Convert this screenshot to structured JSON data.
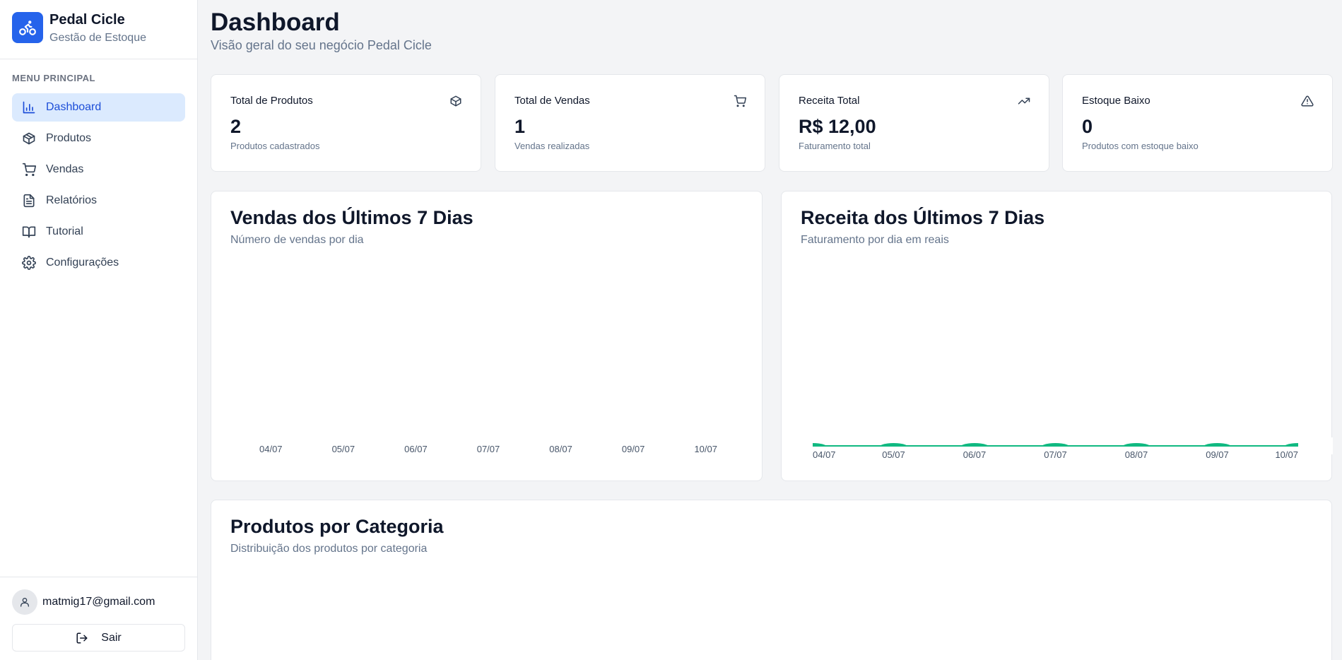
{
  "brand": {
    "name": "Pedal Cicle",
    "subtitle": "Gestão de Estoque"
  },
  "menu": {
    "title": "MENU PRINCIPAL",
    "items": [
      {
        "label": "Dashboard",
        "icon": "bar-chart-icon",
        "active": true
      },
      {
        "label": "Produtos",
        "icon": "package-icon"
      },
      {
        "label": "Vendas",
        "icon": "cart-icon"
      },
      {
        "label": "Relatórios",
        "icon": "file-text-icon"
      },
      {
        "label": "Tutorial",
        "icon": "book-icon"
      },
      {
        "label": "Configurações",
        "icon": "gear-icon"
      }
    ]
  },
  "user": {
    "email": "matmig17@gmail.com",
    "logout_label": "Sair"
  },
  "header": {
    "title": "Dashboard",
    "subtitle": "Visão geral do seu negócio Pedal Cicle"
  },
  "stats": [
    {
      "title": "Total de Produtos",
      "value": "2",
      "description": "Produtos cadastrados",
      "icon": "package-icon"
    },
    {
      "title": "Total de Vendas",
      "value": "1",
      "description": "Vendas realizadas",
      "icon": "cart-icon"
    },
    {
      "title": "Receita Total",
      "value": "R$ 12,00",
      "description": "Faturamento total",
      "icon": "trending-up-icon"
    },
    {
      "title": "Estoque Baixo",
      "value": "0",
      "description": "Produtos com estoque baixo",
      "icon": "alert-triangle-icon"
    }
  ],
  "sales_chart": {
    "title": "Vendas dos Últimos 7 Dias",
    "subtitle": "Número de vendas por dia"
  },
  "revenue_chart": {
    "title": "Receita dos Últimos 7 Dias",
    "subtitle": "Faturamento por dia em reais"
  },
  "category_chart": {
    "title": "Produtos por Categoria",
    "subtitle": "Distribuição dos produtos por categoria"
  },
  "colors": {
    "accent": "#2563eb",
    "revenue_line": "#10b981"
  },
  "chart_data": [
    {
      "type": "bar",
      "categories": [
        "04/07",
        "05/07",
        "06/07",
        "07/07",
        "08/07",
        "09/07",
        "10/07"
      ],
      "values": [
        0,
        0,
        0,
        0,
        0,
        0,
        0
      ]
    },
    {
      "type": "area",
      "x": [
        "04/07",
        "05/07",
        "06/07",
        "07/07",
        "08/07",
        "09/07",
        "10/07"
      ],
      "values": [
        0,
        0,
        0,
        0,
        0,
        0,
        0
      ]
    }
  ]
}
